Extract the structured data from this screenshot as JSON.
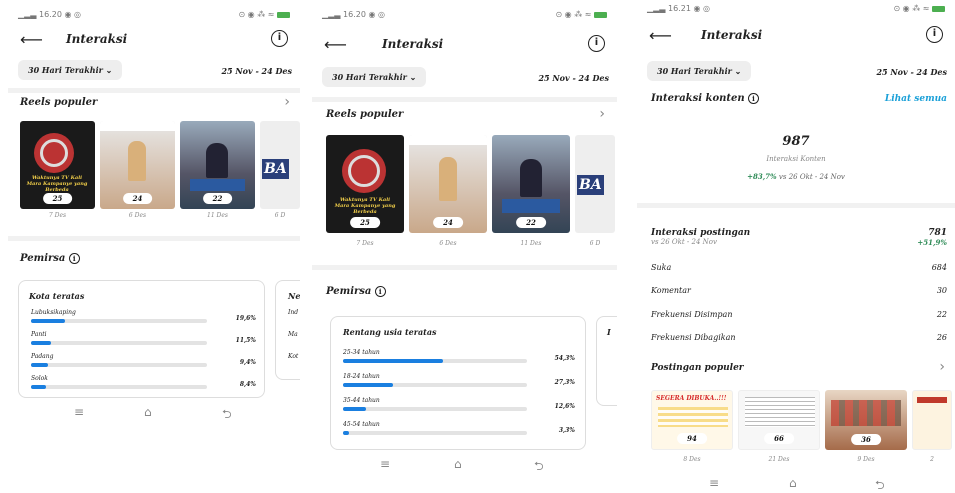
{
  "status": {
    "p1_time": "16.20",
    "p2_time": "16.20",
    "p3_time": "16.21"
  },
  "header": {
    "title": "Interaksi",
    "back_icon": "arrow-left-icon",
    "info_icon": "info-icon"
  },
  "filter": {
    "label": "30 Hari Terakhir",
    "range": "25 Nov - 24 Des"
  },
  "reels": {
    "title": "Reels populer",
    "items": [
      {
        "count": "25",
        "date": "7 Des"
      },
      {
        "count": "24",
        "date": "6 Des"
      },
      {
        "count": "22",
        "date": "11 Des"
      },
      {
        "count": "",
        "date": "6 D"
      }
    ],
    "p2_items": [
      {
        "count": "25",
        "date": "7 Des"
      },
      {
        "count": "24",
        "date": "6 Des"
      },
      {
        "count": "22",
        "date": "11 Des"
      },
      {
        "count": "",
        "date": "6 D"
      }
    ],
    "thumb_text_1": "Waktunya TV Kali Mara Kampanye yang Berbeda",
    "thumb_text_3": "BA"
  },
  "audience": {
    "title": "Pemirsa",
    "cities": {
      "title": "Kota teratas",
      "rows": [
        {
          "label": "Lubuksikaping",
          "value": "19,6%",
          "pct": 19.6
        },
        {
          "label": "Panti",
          "value": "11,5%",
          "pct": 11.5
        },
        {
          "label": "Padang",
          "value": "9,4%",
          "pct": 9.4
        },
        {
          "label": "Solok",
          "value": "8,4%",
          "pct": 8.4
        }
      ]
    },
    "next_card": {
      "title": "Ne",
      "lines": [
        "Ind",
        "Ma",
        "Kot"
      ]
    },
    "ages": {
      "title": "Rentang usia teratas",
      "rows": [
        {
          "label": "25-34 tahun",
          "value": "54,3%",
          "pct": 54.3
        },
        {
          "label": "18-24 tahun",
          "value": "27,3%",
          "pct": 27.3
        },
        {
          "label": "35-44 tahun",
          "value": "12,6%",
          "pct": 12.6
        },
        {
          "label": "45-54 tahun",
          "value": "3,3%",
          "pct": 3.3
        }
      ]
    },
    "next_card2": {
      "title": "I"
    }
  },
  "content": {
    "title": "Interaksi konten",
    "see_all": "Lihat semua",
    "total": "987",
    "total_label": "Interaksi Konten",
    "change": "+83,7%",
    "change_suffix": " vs 26 Okt - 24 Nov"
  },
  "posts": {
    "title": "Interaksi postingan",
    "compare": "vs 26 Okt - 24 Nov",
    "total": "781",
    "change": "+51,9%",
    "rows": [
      {
        "label": "Suka",
        "value": "684"
      },
      {
        "label": "Komentar",
        "value": "30"
      },
      {
        "label": "Frekuensi Disimpan",
        "value": "22"
      },
      {
        "label": "Frekuensi Dibagikan",
        "value": "26"
      }
    ]
  },
  "popular_posts": {
    "title": "Postingan populer",
    "items": [
      {
        "count": "94",
        "date": "8 Des",
        "headline": "SEGERA DIBUKA..!!!"
      },
      {
        "count": "66",
        "date": "21 Des",
        "headline": ""
      },
      {
        "count": "36",
        "date": "9 Des",
        "headline": ""
      },
      {
        "count": "",
        "date": "2",
        "headline": ""
      }
    ]
  },
  "colors": {
    "accent": "#1a7fe0",
    "positive": "#2e8b57",
    "link": "#1aa0d8"
  }
}
